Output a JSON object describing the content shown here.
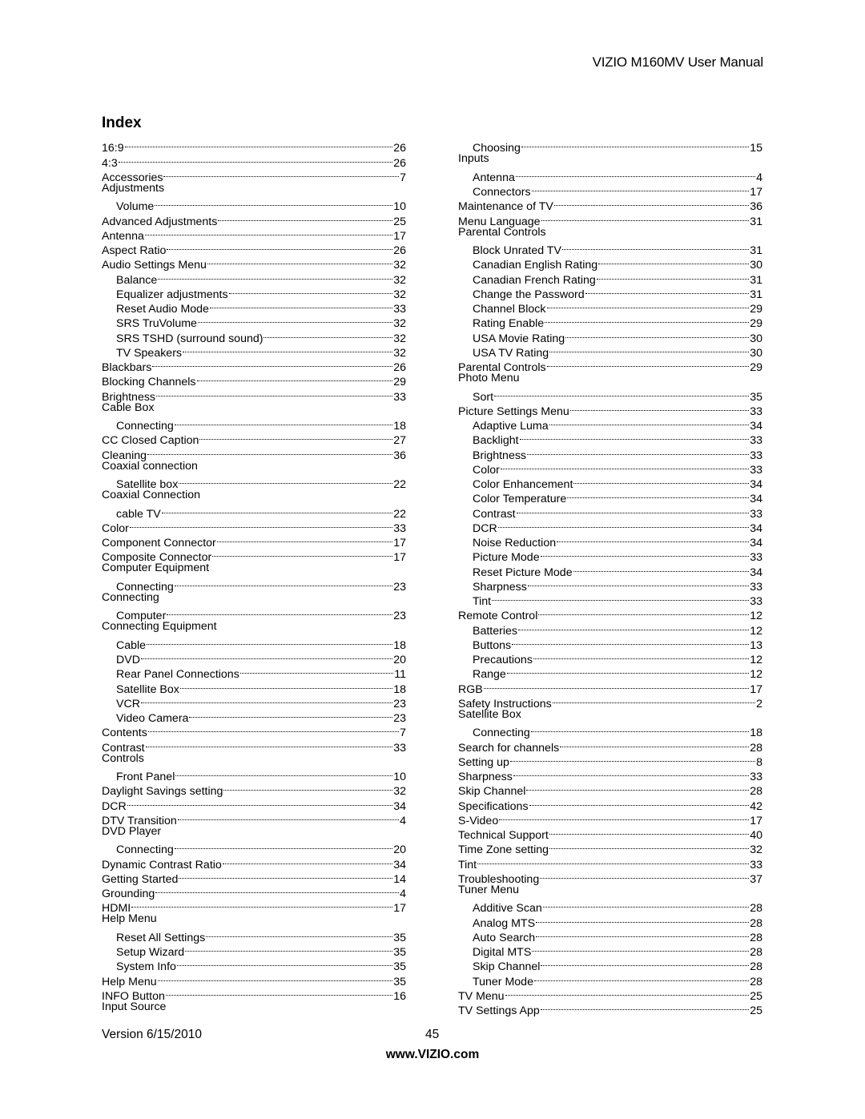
{
  "header": {
    "title": "VIZIO M160MV User Manual"
  },
  "index": {
    "title": "Index",
    "left_column": [
      {
        "label": "16:9",
        "page": "26",
        "level": 0
      },
      {
        "label": "4:3",
        "page": "26",
        "level": 0
      },
      {
        "label": "Accessories",
        "page": "7",
        "level": 0
      },
      {
        "label": "Adjustments",
        "page": "",
        "level": 0
      },
      {
        "label": "Volume",
        "page": "10",
        "level": 1
      },
      {
        "label": "Advanced Adjustments",
        "page": "25",
        "level": 0
      },
      {
        "label": "Antenna",
        "page": "17",
        "level": 0
      },
      {
        "label": "Aspect Ratio",
        "page": "26",
        "level": 0
      },
      {
        "label": "Audio Settings Menu",
        "page": "32",
        "level": 0
      },
      {
        "label": "Balance",
        "page": "32",
        "level": 1
      },
      {
        "label": "Equalizer adjustments",
        "page": "32",
        "level": 1
      },
      {
        "label": "Reset Audio Mode",
        "page": "33",
        "level": 1
      },
      {
        "label": "SRS TruVolume",
        "page": "32",
        "level": 1
      },
      {
        "label": "SRS TSHD (surround sound)",
        "page": "32",
        "level": 1
      },
      {
        "label": "TV Speakers",
        "page": "32",
        "level": 1
      },
      {
        "label": "Blackbars",
        "page": "26",
        "level": 0
      },
      {
        "label": "Blocking Channels",
        "page": "29",
        "level": 0
      },
      {
        "label": "Brightness",
        "page": "33",
        "level": 0
      },
      {
        "label": "Cable Box",
        "page": "",
        "level": 0
      },
      {
        "label": "Connecting",
        "page": "18",
        "level": 1
      },
      {
        "label": "CC Closed Caption",
        "page": "27",
        "level": 0
      },
      {
        "label": "Cleaning",
        "page": "36",
        "level": 0
      },
      {
        "label": "Coaxial connection",
        "page": "",
        "level": 0
      },
      {
        "label": "Satellite box",
        "page": "22",
        "level": 1
      },
      {
        "label": "Coaxial Connection",
        "page": "",
        "level": 0
      },
      {
        "label": "cable TV",
        "page": "22",
        "level": 1
      },
      {
        "label": "Color",
        "page": "33",
        "level": 0
      },
      {
        "label": "Component Connector",
        "page": "17",
        "level": 0
      },
      {
        "label": "Composite Connector",
        "page": "17",
        "level": 0
      },
      {
        "label": "Computer Equipment",
        "page": "",
        "level": 0
      },
      {
        "label": "Connecting",
        "page": "23",
        "level": 1
      },
      {
        "label": "Connecting",
        "page": "",
        "level": 0
      },
      {
        "label": "Computer",
        "page": "23",
        "level": 1
      },
      {
        "label": "Connecting Equipment",
        "page": "",
        "level": 0
      },
      {
        "label": "Cable",
        "page": "18",
        "level": 1
      },
      {
        "label": "DVD",
        "page": "20",
        "level": 1
      },
      {
        "label": "Rear Panel Connections",
        "page": "11",
        "level": 1
      },
      {
        "label": "Satellite Box",
        "page": "18",
        "level": 1
      },
      {
        "label": "VCR",
        "page": "23",
        "level": 1
      },
      {
        "label": "Video Camera",
        "page": "23",
        "level": 1
      },
      {
        "label": "Contents",
        "page": "7",
        "level": 0
      },
      {
        "label": "Contrast",
        "page": "33",
        "level": 0
      },
      {
        "label": "Controls",
        "page": "",
        "level": 0
      },
      {
        "label": "Front Panel",
        "page": "10",
        "level": 1
      },
      {
        "label": "Daylight Savings setting",
        "page": "32",
        "level": 0
      },
      {
        "label": "DCR",
        "page": "34",
        "level": 0
      },
      {
        "label": "DTV Transition",
        "page": "4",
        "level": 0
      },
      {
        "label": "DVD Player",
        "page": "",
        "level": 0
      },
      {
        "label": "Connecting",
        "page": "20",
        "level": 1
      },
      {
        "label": "Dynamic Contrast Ratio",
        "page": "34",
        "level": 0
      },
      {
        "label": "Getting Started",
        "page": "14",
        "level": 0
      },
      {
        "label": "Grounding",
        "page": "4",
        "level": 0
      },
      {
        "label": "HDMI",
        "page": "17",
        "level": 0
      },
      {
        "label": "Help Menu",
        "page": "",
        "level": 0
      },
      {
        "label": "Reset All Settings",
        "page": "35",
        "level": 1
      },
      {
        "label": "Setup Wizard",
        "page": "35",
        "level": 1
      },
      {
        "label": "System Info",
        "page": "35",
        "level": 1
      },
      {
        "label": "Help Menu",
        "page": "35",
        "level": 0
      },
      {
        "label": "INFO Button",
        "page": "16",
        "level": 0
      },
      {
        "label": "Input Source",
        "page": "",
        "level": 0
      }
    ],
    "right_column": [
      {
        "label": "Choosing",
        "page": "15",
        "level": 1
      },
      {
        "label": "Inputs",
        "page": "",
        "level": 0
      },
      {
        "label": "Antenna",
        "page": "4",
        "level": 1
      },
      {
        "label": "Connectors",
        "page": "17",
        "level": 1
      },
      {
        "label": "Maintenance of TV",
        "page": "36",
        "level": 0
      },
      {
        "label": "Menu Language",
        "page": "31",
        "level": 0
      },
      {
        "label": "Parental Controls",
        "page": "",
        "level": 0
      },
      {
        "label": "Block Unrated TV",
        "page": "31",
        "level": 1
      },
      {
        "label": "Canadian English Rating",
        "page": "30",
        "level": 1
      },
      {
        "label": "Canadian French Rating",
        "page": "31",
        "level": 1
      },
      {
        "label": "Change the Password",
        "page": "31",
        "level": 1
      },
      {
        "label": "Channel Block",
        "page": "29",
        "level": 1
      },
      {
        "label": "Rating Enable",
        "page": "29",
        "level": 1
      },
      {
        "label": "USA Movie Rating",
        "page": "30",
        "level": 1
      },
      {
        "label": "USA TV Rating",
        "page": "30",
        "level": 1
      },
      {
        "label": "Parental Controls",
        "page": "29",
        "level": 0
      },
      {
        "label": "Photo Menu",
        "page": "",
        "level": 0
      },
      {
        "label": "Sort",
        "page": "35",
        "level": 1
      },
      {
        "label": "Picture Settings Menu",
        "page": "33",
        "level": 0
      },
      {
        "label": "Adaptive Luma",
        "page": "34",
        "level": 1
      },
      {
        "label": "Backlight",
        "page": "33",
        "level": 1
      },
      {
        "label": "Brightness",
        "page": "33",
        "level": 1
      },
      {
        "label": "Color",
        "page": "33",
        "level": 1
      },
      {
        "label": "Color Enhancement",
        "page": "34",
        "level": 1
      },
      {
        "label": "Color Temperature",
        "page": "34",
        "level": 1
      },
      {
        "label": "Contrast",
        "page": "33",
        "level": 1
      },
      {
        "label": "DCR",
        "page": "34",
        "level": 1
      },
      {
        "label": "Noise Reduction",
        "page": "34",
        "level": 1
      },
      {
        "label": "Picture Mode",
        "page": "33",
        "level": 1
      },
      {
        "label": "Reset Picture Mode",
        "page": "34",
        "level": 1
      },
      {
        "label": "Sharpness",
        "page": "33",
        "level": 1
      },
      {
        "label": "Tint",
        "page": "33",
        "level": 1
      },
      {
        "label": "Remote Control",
        "page": "12",
        "level": 0
      },
      {
        "label": "Batteries",
        "page": "12",
        "level": 1
      },
      {
        "label": "Buttons",
        "page": "13",
        "level": 1
      },
      {
        "label": "Precautions",
        "page": "12",
        "level": 1
      },
      {
        "label": "Range",
        "page": "12",
        "level": 1
      },
      {
        "label": "RGB",
        "page": "17",
        "level": 0
      },
      {
        "label": "Safety Instructions",
        "page": "2",
        "level": 0
      },
      {
        "label": "Satellite Box",
        "page": "",
        "level": 0
      },
      {
        "label": "Connecting",
        "page": "18",
        "level": 1
      },
      {
        "label": "Search for channels",
        "page": "28",
        "level": 0
      },
      {
        "label": "Setting up",
        "page": "8",
        "level": 0
      },
      {
        "label": "Sharpness",
        "page": "33",
        "level": 0
      },
      {
        "label": "Skip Channel",
        "page": "28",
        "level": 0
      },
      {
        "label": "Specifications",
        "page": "42",
        "level": 0
      },
      {
        "label": "S-Video",
        "page": "17",
        "level": 0
      },
      {
        "label": "Technical Support",
        "page": "40",
        "level": 0
      },
      {
        "label": "Time Zone setting",
        "page": "32",
        "level": 0
      },
      {
        "label": "Tint",
        "page": "33",
        "level": 0
      },
      {
        "label": "Troubleshooting",
        "page": "37",
        "level": 0
      },
      {
        "label": "Tuner Menu",
        "page": "",
        "level": 0
      },
      {
        "label": "Additive Scan",
        "page": "28",
        "level": 1
      },
      {
        "label": "Analog MTS",
        "page": "28",
        "level": 1
      },
      {
        "label": "Auto Search",
        "page": "28",
        "level": 1
      },
      {
        "label": "Digital MTS",
        "page": "28",
        "level": 1
      },
      {
        "label": "Skip Channel",
        "page": "28",
        "level": 1
      },
      {
        "label": "Tuner Mode",
        "page": "28",
        "level": 1
      },
      {
        "label": "TV Menu",
        "page": "25",
        "level": 0
      },
      {
        "label": "TV Settings App",
        "page": "25",
        "level": 0
      }
    ]
  },
  "footer": {
    "version": "Version 6/15/2010",
    "page_number": "45",
    "url": "www.VIZIO.com"
  }
}
